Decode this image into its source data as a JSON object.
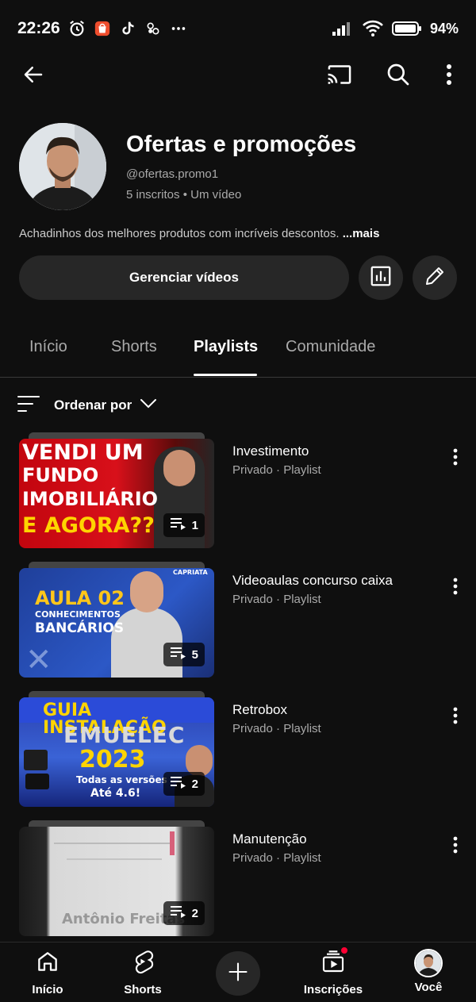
{
  "status_bar": {
    "time": "22:26",
    "battery": "94%",
    "icons_left": [
      "alarm-icon",
      "shopee-icon",
      "tiktok-icon",
      "app-icon",
      "more-dots-icon"
    ],
    "icons_right": [
      "signal-icon",
      "wifi-icon",
      "battery-icon"
    ]
  },
  "top_bar": {
    "icons": [
      "back-arrow-icon",
      "cast-icon",
      "search-icon",
      "more-vert-icon"
    ]
  },
  "channel": {
    "name": "Ofertas e promoções",
    "handle": "@ofertas.promo1",
    "meta": "5 inscritos • Um vídeo",
    "description": "Achadinhos dos melhores produtos com incríveis descontos.",
    "more": "...mais",
    "manage_label": "Gerenciar vídeos"
  },
  "tabs": [
    {
      "label": "Início",
      "active": false
    },
    {
      "label": "Shorts",
      "active": false
    },
    {
      "label": "Playlists",
      "active": true
    },
    {
      "label": "Comunidade",
      "active": false
    }
  ],
  "sort": {
    "label": "Ordenar por"
  },
  "playlists": [
    {
      "title": "Investimento",
      "subtitle": "Privado · Playlist",
      "count": "1",
      "thumb_lines": [
        "VENDI UM",
        "FUNDO",
        "IMOBILIÁRIO",
        "E AGORA??"
      ]
    },
    {
      "title": "Videoaulas concurso caixa",
      "subtitle": "Privado · Playlist",
      "count": "5",
      "thumb_lines": [
        "AULA 02",
        "CONHECIMENTOS",
        "BANCÁRIOS",
        "CAPRIATA"
      ]
    },
    {
      "title": "Retrobox",
      "subtitle": "Privado · Playlist",
      "count": "2",
      "thumb_lines": [
        "GUIA INSTALAÇÃO",
        "EMUELEC",
        "2023",
        "Todas as versões",
        "Até 4.6!"
      ]
    },
    {
      "title": "Manutenção",
      "subtitle": "Privado · Playlist",
      "count": "2",
      "thumb_lines": [
        "Antônio Freitas"
      ]
    }
  ],
  "bottom_nav": [
    {
      "label": "Início",
      "icon": "home-icon"
    },
    {
      "label": "Shorts",
      "icon": "shorts-icon"
    },
    {
      "label": "",
      "icon": "create-plus-icon"
    },
    {
      "label": "Inscrições",
      "icon": "subscriptions-icon"
    },
    {
      "label": "Você",
      "icon": "profile-avatar-icon"
    }
  ],
  "colors": {
    "background": "#0f0f0f",
    "surface": "#272727",
    "text_secondary": "#aaaaaa",
    "notification_dot": "#ff0033"
  }
}
